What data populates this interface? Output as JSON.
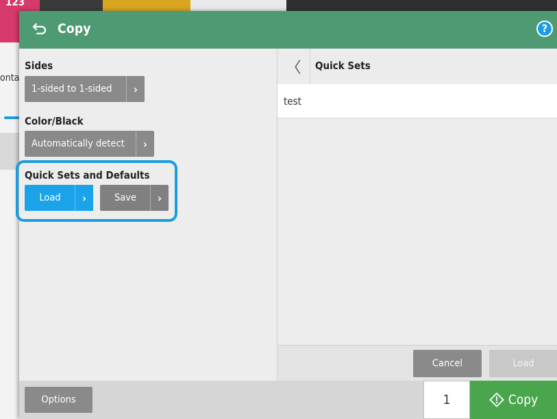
{
  "background": {
    "tile_number": "123",
    "fragment_text": "onta"
  },
  "header": {
    "title": "Copy",
    "help_label": "?"
  },
  "settings": {
    "sides": {
      "label": "Sides",
      "value": "1-sided to 1-sided"
    },
    "color_black": {
      "label": "Color/Black",
      "value": "Automatically detect"
    },
    "quick_sets": {
      "label": "Quick Sets and Defaults",
      "load_label": "Load",
      "save_label": "Save"
    }
  },
  "quick_sets_panel": {
    "back_icon": "chevron-left-icon",
    "title": "Quick Sets",
    "items": [
      "test"
    ],
    "cancel_label": "Cancel",
    "load_label": "Load"
  },
  "bottom": {
    "options_label": "Options",
    "copies": "1",
    "copy_label": "Copy"
  },
  "colors": {
    "title_bar": "#4e9a72",
    "accent_blue": "#1aa3e8",
    "copy_green": "#4aa64d",
    "button_grey": "#8a8a8a"
  }
}
